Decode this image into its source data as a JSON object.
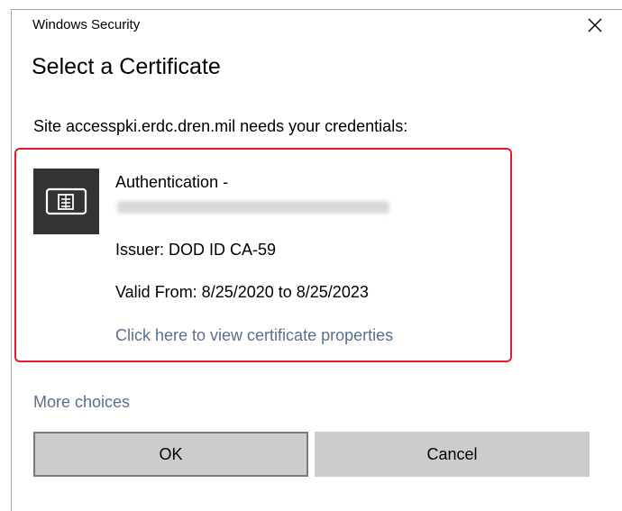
{
  "window": {
    "title": "Windows Security",
    "close_icon": "close-icon"
  },
  "dialog": {
    "heading": "Select a Certificate",
    "site_message": "Site accesspki.erdc.dren.mil needs your credentials:"
  },
  "certificate": {
    "icon": "certificate-card-icon",
    "title": "Authentication -",
    "subject_redacted": true,
    "issuer": "Issuer: DOD ID CA-59",
    "valid": "Valid From: 8/25/2020 to 8/25/2023",
    "properties_link": "Click here to view certificate properties",
    "highlight_color": "#e8192c"
  },
  "more_choices": "More choices",
  "buttons": {
    "ok_label": "OK",
    "cancel_label": "Cancel"
  },
  "colors": {
    "link": "#5b6f8a",
    "button_bg": "#cccccc",
    "icon_bg": "#333333"
  }
}
